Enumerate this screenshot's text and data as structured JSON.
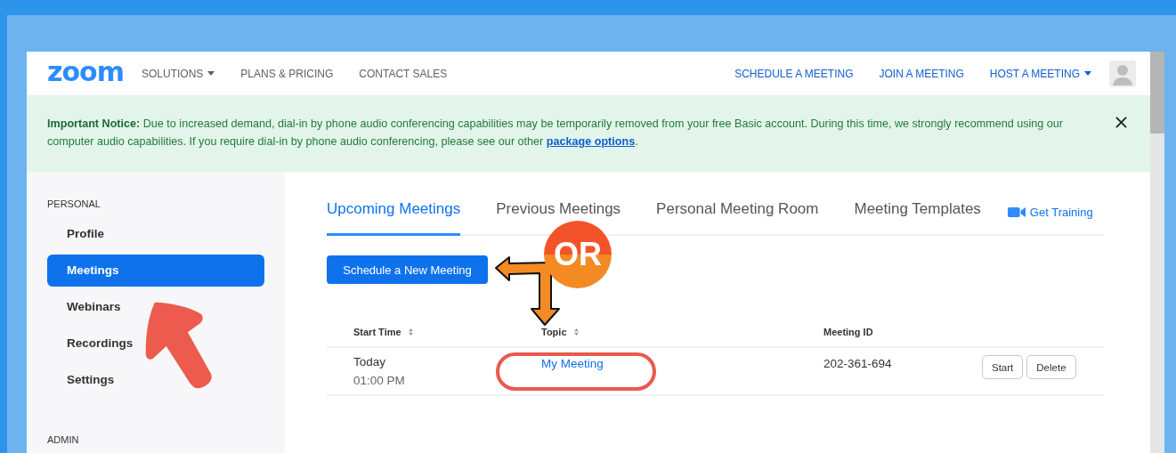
{
  "nav": {
    "logo": "zoom",
    "left_links": [
      {
        "label": "SOLUTIONS",
        "dropdown": true
      },
      {
        "label": "PLANS & PRICING",
        "dropdown": false
      },
      {
        "label": "CONTACT SALES",
        "dropdown": false
      }
    ],
    "right_links": [
      {
        "label": "SCHEDULE A MEETING",
        "dropdown": false
      },
      {
        "label": "JOIN A MEETING",
        "dropdown": false
      },
      {
        "label": "HOST A MEETING",
        "dropdown": true
      }
    ]
  },
  "notice": {
    "text": "**Important Notice:** Due to increased demand, dial-in by phone audio conferencing capabilities may be temporarily removed from your free Basic account. During this time, we strongly recommend using our computer audio capabilities. If you require dial-in by phone audio conferencing, please see our other",
    "link": "package options",
    "after": "."
  },
  "sidebar": {
    "sections": [
      {
        "title": "PERSONAL",
        "items": [
          {
            "label": "Profile",
            "selected": false
          },
          {
            "label": "Meetings",
            "selected": true
          },
          {
            "label": "Webinars",
            "selected": false
          },
          {
            "label": "Recordings",
            "selected": false
          },
          {
            "label": "Settings",
            "selected": false
          }
        ]
      },
      {
        "title": "ADMIN"
      }
    ]
  },
  "tabs": [
    {
      "label": "Upcoming Meetings",
      "selected": true
    },
    {
      "label": "Previous Meetings",
      "selected": false
    },
    {
      "label": "Personal Meeting Room",
      "selected": false
    },
    {
      "label": "Meeting Templates",
      "selected": false
    }
  ],
  "training_link": "Get Training",
  "schedule_button": "Schedule a New Meeting",
  "table": {
    "columns": [
      {
        "label": "Start Time",
        "sortable": true
      },
      {
        "label": "Topic",
        "sortable": true
      },
      {
        "label": "Meeting ID",
        "sortable": false
      }
    ],
    "rows": [
      {
        "date": "Today",
        "time": "01:00 PM",
        "topic": "My Meeting",
        "meeting_id": "202-361-694",
        "actions": [
          "Start",
          "Delete"
        ]
      }
    ]
  },
  "annotations": {
    "badge": "OR"
  }
}
